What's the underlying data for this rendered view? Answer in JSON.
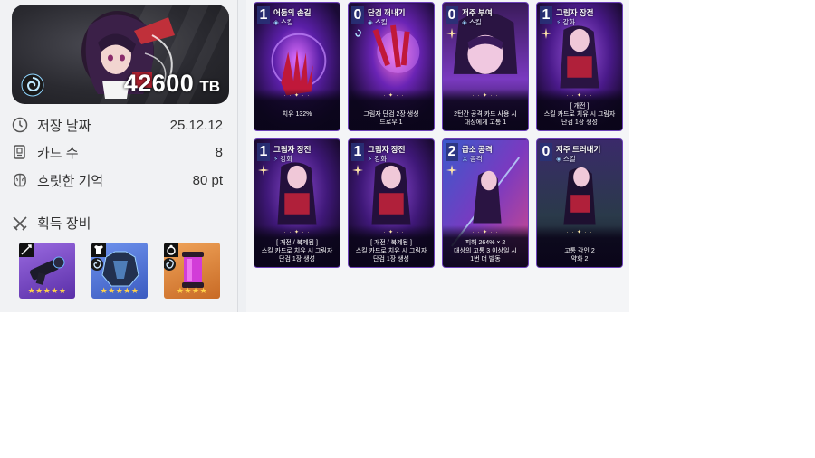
{
  "profile": {
    "currency_value": "42600",
    "currency_unit": "TB"
  },
  "stats": [
    {
      "label": "저장 날짜",
      "value": "25.12.12",
      "icon": "clock-icon"
    },
    {
      "label": "카드 수",
      "value": "8",
      "icon": "card-deck-icon"
    },
    {
      "label": "흐릿한 기억",
      "value": "80 pt",
      "icon": "brain-icon"
    }
  ],
  "equipment": {
    "title": "획득 장비",
    "items": [
      {
        "name": "weapon",
        "type_icon": "sword-icon",
        "stars": "★★★★★",
        "color": "#7f53c9"
      },
      {
        "name": "armor",
        "type_icon": "shirt-icon",
        "stars": "★★★★★",
        "color": "#4a6fd6"
      },
      {
        "name": "ring",
        "type_icon": "ring-icon",
        "stars": "★★★★",
        "color": "#e08a3e"
      }
    ]
  },
  "cards": [
    {
      "cost": "1",
      "name": "어둠의 손길",
      "type": "스킬",
      "type_icon": "skill-icon",
      "line1": "",
      "line2": "치유 132%",
      "line3": ""
    },
    {
      "cost": "0",
      "name": "단검 꺼내기",
      "type": "스킬",
      "type_icon": "skill-icon",
      "line1": "",
      "line2": "그림자 단검 2장 생성",
      "line3": "드로우 1"
    },
    {
      "cost": "0",
      "name": "저주 부여",
      "type": "스킬",
      "type_icon": "skill-icon",
      "line1": "",
      "line2": "2턴간 공격 카드 사용 시",
      "line3": "대상에게 고통 1"
    },
    {
      "cost": "1",
      "name": "그림자 장전",
      "type": "강화",
      "type_icon": "enhance-icon",
      "line1": "[ 개전 ]",
      "line2": "스킬 카드로 치유 시 그림자",
      "line3": "단검 1장 생성"
    },
    {
      "cost": "1",
      "name": "그림자 장전",
      "type": "강화",
      "type_icon": "enhance-icon",
      "line1": "[ 개전 / 복제됨 ]",
      "line2": "스킬 카드로 치유 시 그림자",
      "line3": "단검 1장 생성"
    },
    {
      "cost": "1",
      "name": "그림자 장전",
      "type": "강화",
      "type_icon": "enhance-icon",
      "line1": "[ 개전 / 복제됨 ]",
      "line2": "스킬 카드로 치유 시 그림자",
      "line3": "단검 1장 생성"
    },
    {
      "cost": "2",
      "name": "급소 공격",
      "type": "공격",
      "type_icon": "attack-icon",
      "line1": "피해 264% × 2",
      "line2": "대상의 고통 3 이상일 시",
      "line3": "1번 더 발동"
    },
    {
      "cost": "0",
      "name": "저주 드러내기",
      "type": "스킬",
      "type_icon": "skill-icon",
      "line1": "",
      "line2": "고통 각인 2",
      "line3": "약화 2"
    }
  ]
}
